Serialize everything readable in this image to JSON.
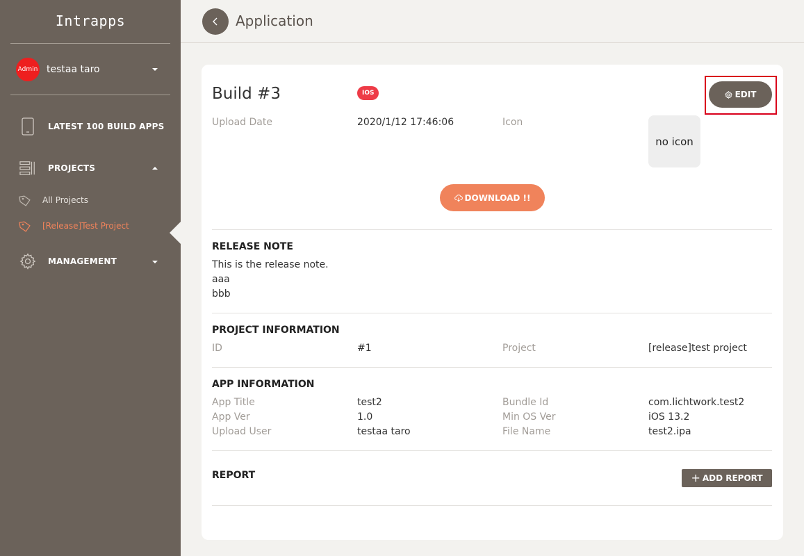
{
  "sidebar": {
    "brand": "Intrapps",
    "user": {
      "avatar_label": "Admin",
      "name": "testaa taro"
    },
    "nav": {
      "latest": "LATEST 100 BUILD APPS",
      "projects": "PROJECTS",
      "projects_items": [
        "All Projects",
        "[Release]Test Project"
      ],
      "management": "MANAGEMENT"
    }
  },
  "header": {
    "title": "Application"
  },
  "build": {
    "title": "Build #3",
    "os_badge": "IOS",
    "edit_label": "EDIT",
    "upload_date_label": "Upload Date",
    "upload_date": "2020/1/12 17:46:06",
    "icon_label": "Icon",
    "no_icon": "no icon",
    "download_label": "DOWNLOAD !!"
  },
  "release_note": {
    "title": "RELEASE NOTE",
    "lines": [
      "This is the release note.",
      "aaa",
      "bbb"
    ]
  },
  "project_info": {
    "title": "PROJECT INFORMATION",
    "id_label": "ID",
    "id": "#1",
    "project_label": "Project",
    "project": "[release]test project"
  },
  "app_info": {
    "title": "APP INFORMATION",
    "rows": [
      {
        "l1": "App Title",
        "v1": "test2",
        "l2": "Bundle Id",
        "v2": "com.lichtwork.test2"
      },
      {
        "l1": "App Ver",
        "v1": "1.0",
        "l2": "Min OS Ver",
        "v2": "iOS 13.2"
      },
      {
        "l1": "Upload User",
        "v1": "testaa taro",
        "l2": "File Name",
        "v2": "test2.ipa"
      }
    ]
  },
  "report": {
    "title": "REPORT",
    "add_label": "ADD REPORT"
  },
  "colors": {
    "sidebar": "#6b625a",
    "accent": "#f0835b",
    "badge": "#ee3b47",
    "highlight": "#d9001b"
  }
}
